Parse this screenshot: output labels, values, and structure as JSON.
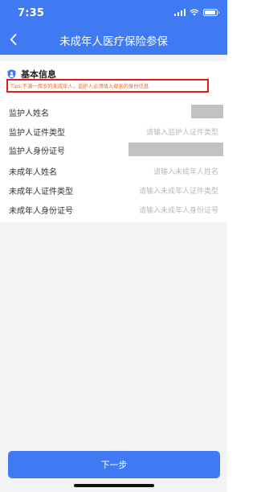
{
  "status_bar": {
    "time": "7:35"
  },
  "nav": {
    "title": "未成年人医疗保险参保"
  },
  "section": {
    "title": "基本信息",
    "tips": "Tips:不满一周岁的未成年人，监护人必须填入母亲的身份信息"
  },
  "form": {
    "fields": [
      {
        "label": "监护人姓名",
        "placeholder": ""
      },
      {
        "label": "监护人证件类型",
        "placeholder": "请输入监护人证件类型"
      },
      {
        "label": "监护人身份证号",
        "placeholder": ""
      },
      {
        "label": "未成年人姓名",
        "placeholder": "请输入未成年人姓名"
      },
      {
        "label": "未成年人证件类型",
        "placeholder": "请输入未成年人证件类型"
      },
      {
        "label": "未成年人身份证号",
        "placeholder": "请输入未成年人身份证号"
      }
    ]
  },
  "footer": {
    "next_label": "下一步"
  },
  "colors": {
    "primary": "#3f7af3",
    "tips_border": "#e41a1a",
    "tips_text": "#ea6b2d"
  }
}
